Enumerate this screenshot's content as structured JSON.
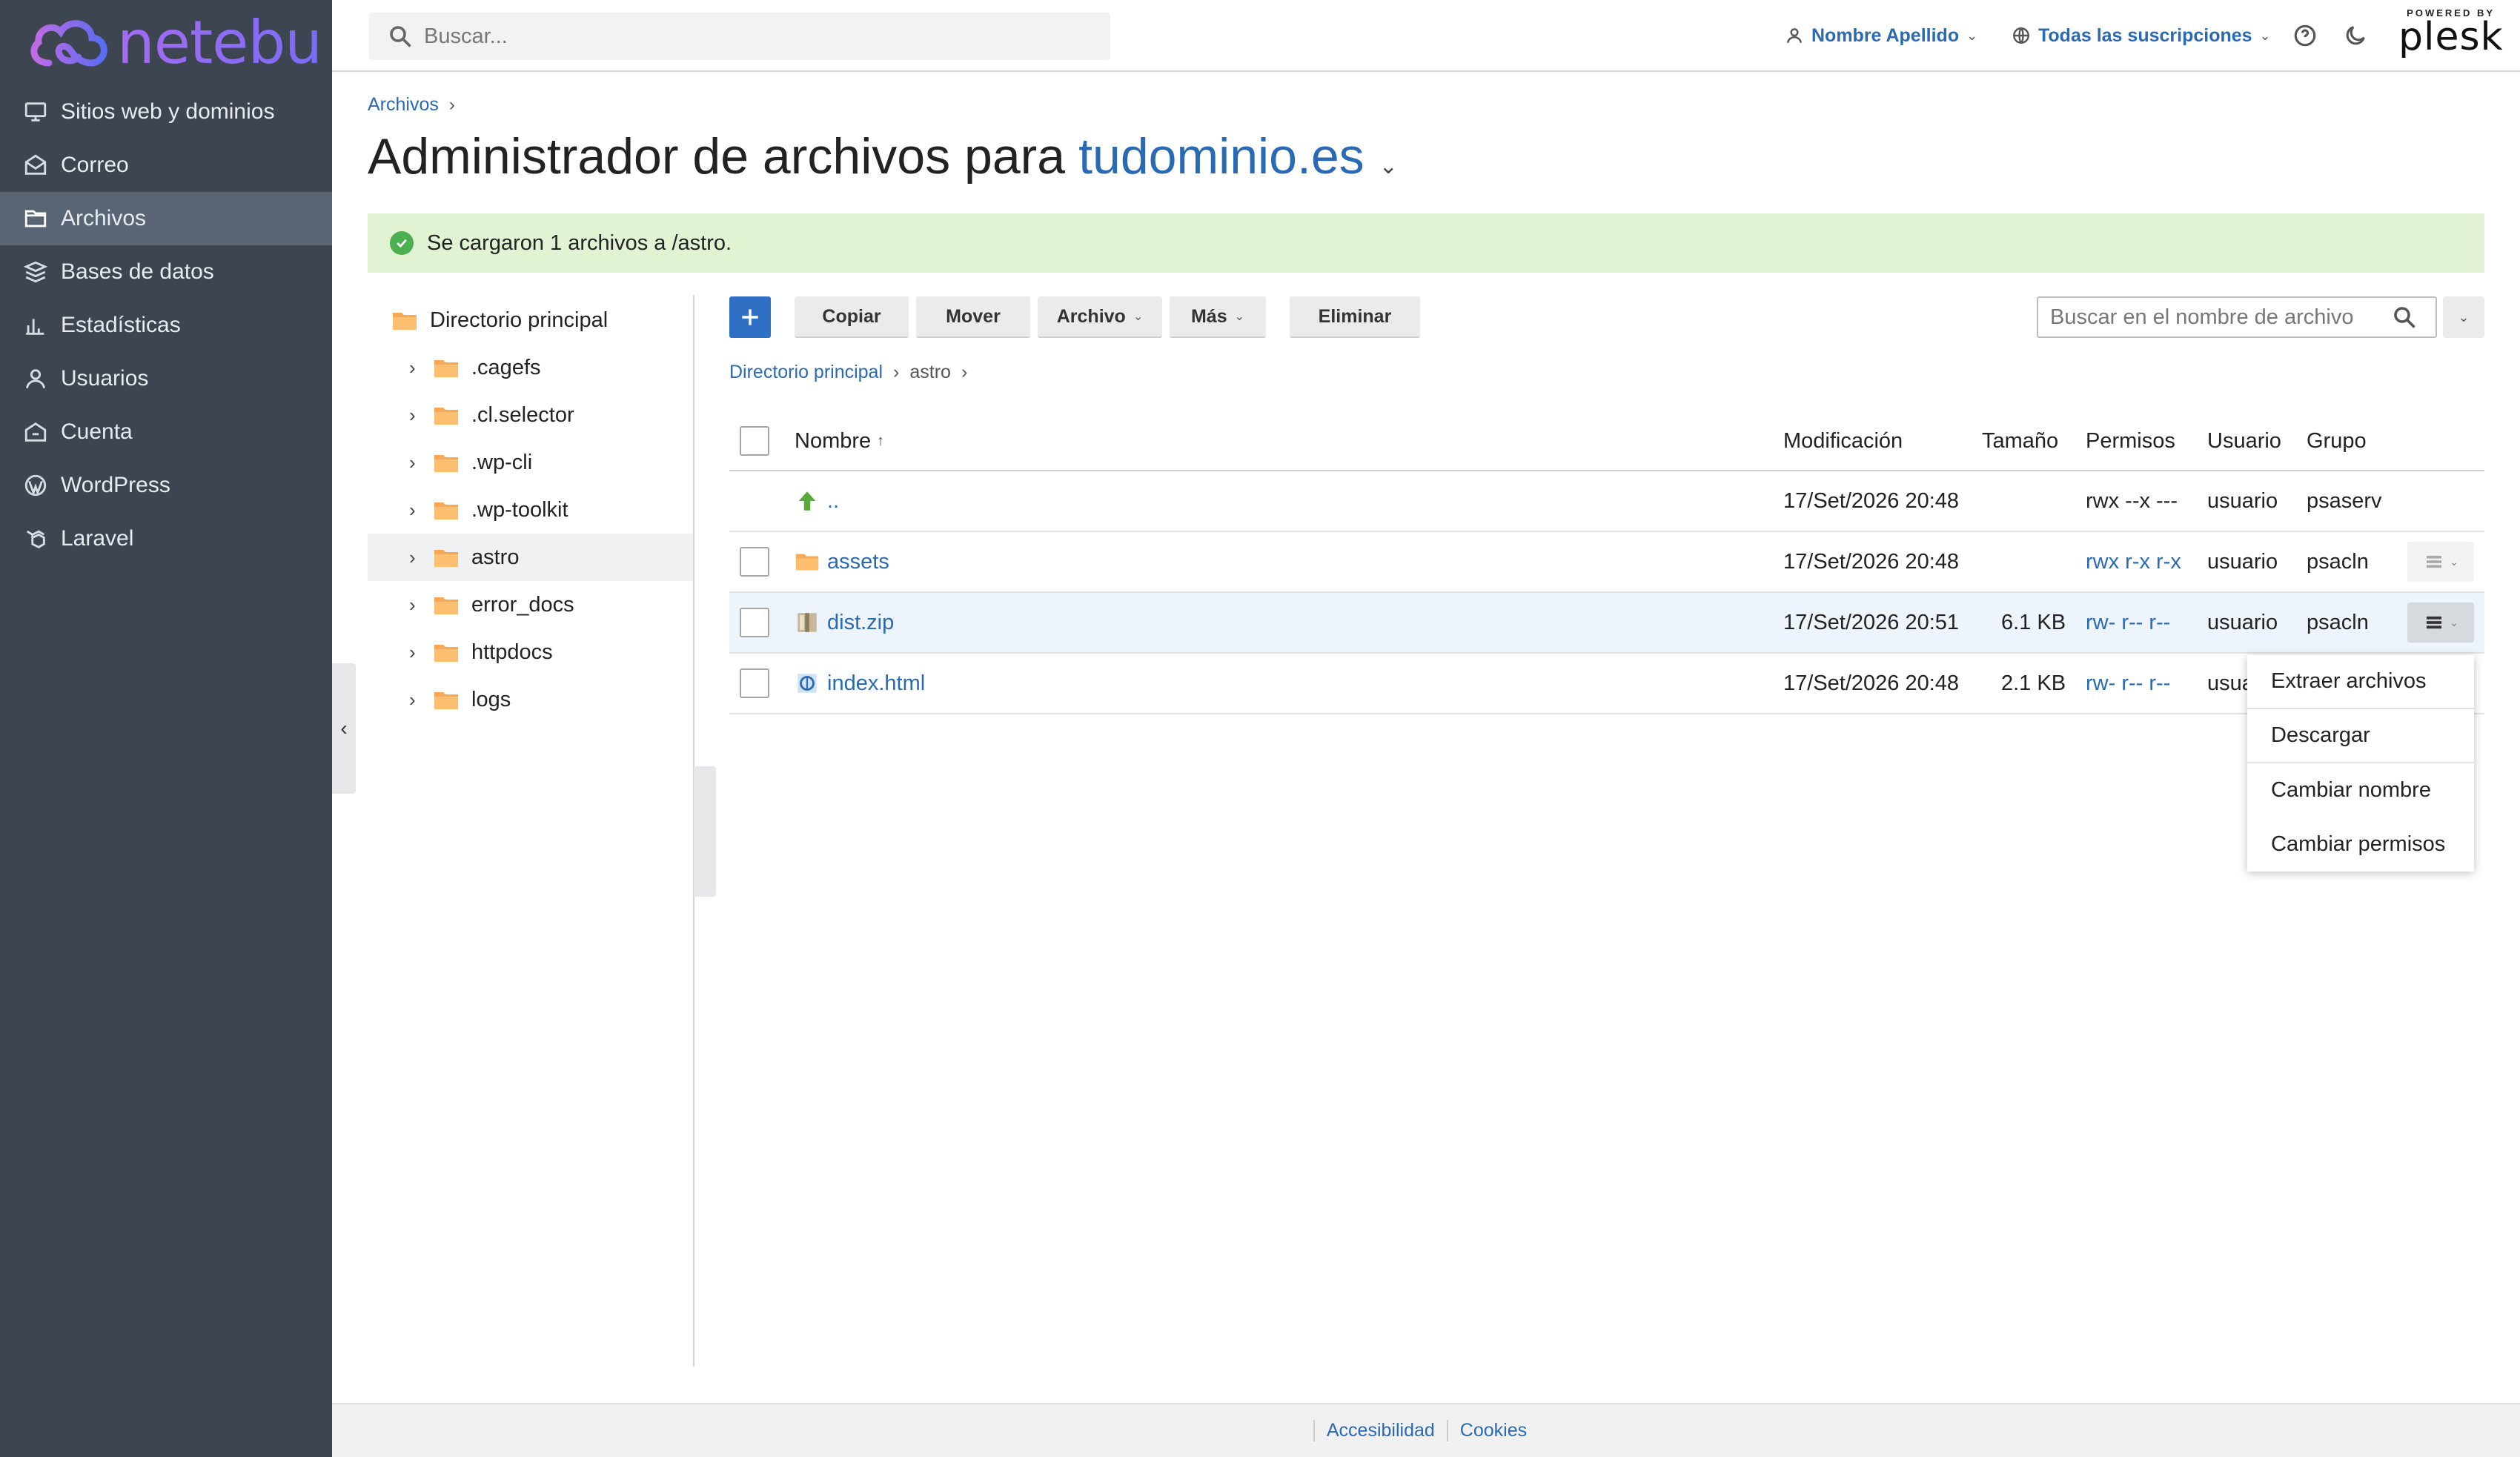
{
  "brand": {
    "name": "netebu"
  },
  "sidebar": {
    "items": [
      {
        "label": "Sitios web y dominios",
        "icon": "monitor-icon"
      },
      {
        "label": "Correo",
        "icon": "mail-icon"
      },
      {
        "label": "Archivos",
        "icon": "folder-icon",
        "active": true
      },
      {
        "label": "Bases de datos",
        "icon": "database-icon"
      },
      {
        "label": "Estadísticas",
        "icon": "bar-chart-icon"
      },
      {
        "label": "Usuarios",
        "icon": "user-icon"
      },
      {
        "label": "Cuenta",
        "icon": "account-icon"
      },
      {
        "label": "WordPress",
        "icon": "wordpress-icon"
      },
      {
        "label": "Laravel",
        "icon": "laravel-icon"
      }
    ]
  },
  "topbar": {
    "search_placeholder": "Buscar...",
    "user_name": "Nombre Apellido",
    "subscriptions": "Todas las suscripciones",
    "powered_by": "POWERED BY",
    "plesk": "plesk"
  },
  "breadcrumb": {
    "root": "Archivos"
  },
  "title": {
    "prefix": "Administrador de archivos para",
    "domain": "tudominio.es"
  },
  "alert": {
    "message": "Se cargaron 1 archivos a /astro."
  },
  "tree": {
    "root": "Directorio principal",
    "children": [
      ".cagefs",
      ".cl.selector",
      ".wp-cli",
      ".wp-toolkit",
      "astro",
      "error_docs",
      "httpdocs",
      "logs"
    ],
    "selected": "astro"
  },
  "toolbar": {
    "copy": "Copiar",
    "move": "Mover",
    "file": "Archivo",
    "more": "Más",
    "delete": "Eliminar",
    "search_placeholder": "Buscar en el nombre de archivo"
  },
  "path": {
    "root": "Directorio principal",
    "current": "astro"
  },
  "table": {
    "headers": {
      "name": "Nombre",
      "modified": "Modificación",
      "size": "Tamaño",
      "perms": "Permisos",
      "user": "Usuario",
      "group": "Grupo"
    },
    "rows": [
      {
        "name": "..",
        "type": "up",
        "modified": "17/Set/2026 20:48",
        "size": "",
        "perms": "rwx --x ---",
        "user": "usuario",
        "group": "psaserv"
      },
      {
        "name": "assets",
        "type": "folder",
        "modified": "17/Set/2026 20:48",
        "size": "",
        "perms": "rwx r-x r-x",
        "user": "usuario",
        "group": "psacln"
      },
      {
        "name": "dist.zip",
        "type": "zip",
        "modified": "17/Set/2026 20:51",
        "size": "6.1 KB",
        "perms": "rw- r-- r--",
        "user": "usuario",
        "group": "psacln"
      },
      {
        "name": "index.html",
        "type": "html",
        "modified": "17/Set/2026 20:48",
        "size": "2.1 KB",
        "perms": "rw- r-- r--",
        "user": "usua",
        "group": ""
      }
    ]
  },
  "context_menu": {
    "items": [
      "Extraer archivos",
      "Descargar",
      "Cambiar nombre",
      "Cambiar permisos"
    ]
  },
  "footer": {
    "accessibility": "Accesibilidad",
    "cookies": "Cookies"
  },
  "colors": {
    "sidebar": "#3c4550",
    "accent": "#2a6ab4",
    "alert": "#e1f3d3",
    "primary_button": "#2f6fc4"
  }
}
